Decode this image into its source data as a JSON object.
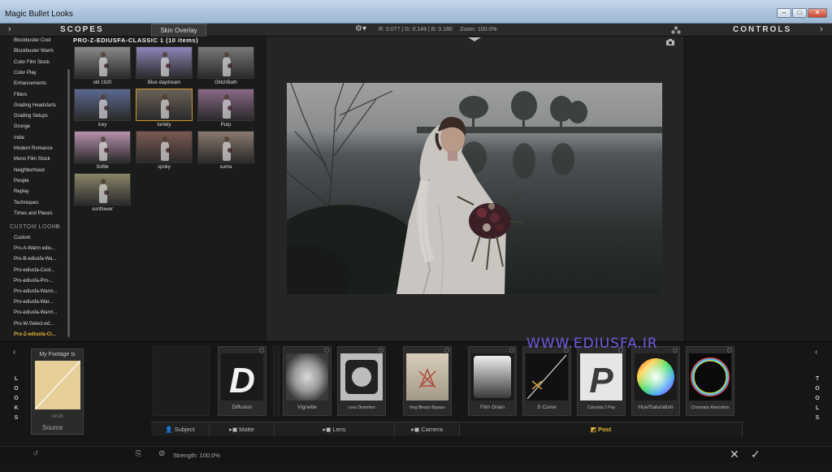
{
  "window": {
    "title": "Magic Bullet Looks",
    "buttons": [
      "–",
      "□",
      "✕"
    ]
  },
  "header": {
    "scopes_title": "SCOPES",
    "skin_tab": "Skin Overlay",
    "rgb_readout": "R: 0.077 | G: 0.149 | B: 0.180",
    "zoom_readout": "Zoom: 100.0%",
    "controls_title": "CONTROLS"
  },
  "looks_list": {
    "items": [
      "Blockbuster Cool",
      "Blockbuster Warm",
      "Color Film Stock",
      "Color Play",
      "Enhancements",
      "Filters",
      "Grading Headstarts",
      "Grading Setups",
      "Grunge",
      "Indie",
      "Modern Romance",
      "Mono Film Stock",
      "Neighborhood",
      "People",
      "Replay",
      "Techniques",
      "Times and Places"
    ],
    "custom_header": "CUSTOM LOOKS",
    "custom_items": [
      "Custom",
      "Pro-A-Warm ediu...",
      "Pro-B-ediusfa-Wa...",
      "Pro-ediusfa-Cool...",
      "Pro-ediusfa-Pro-...",
      "Pro-ediusfa-Warm...",
      "Pro-ediusfa-War...",
      "Pro-ediusfa-Warm...",
      "Pro-W-Select-ed...",
      "Pro-Z-ediusfa-Cl..."
    ],
    "active_item": "Pro-Z-ediusfa-Cl..."
  },
  "looks_grid": {
    "title": "PRO-Z-EDIUSFA-CLASSIC 1 (10 items)",
    "thumbs": [
      {
        "label": "old 1920",
        "bg": "#8a8a8a"
      },
      {
        "label": "Blue daydream",
        "bg": "#8e85b8"
      },
      {
        "label": "GlitchBath",
        "bg": "#787878"
      },
      {
        "label": "icey",
        "bg": "#5c6a90"
      },
      {
        "label": "lonlely",
        "bg": "#6a6258"
      },
      {
        "label": "Purp",
        "bg": "#8a6a86"
      },
      {
        "label": "Sofite",
        "bg": "#b892ad"
      },
      {
        "label": "spoky",
        "bg": "#7a5a52"
      },
      {
        "label": "suma",
        "bg": "#8a7a70"
      },
      {
        "label": "sunflower",
        "bg": "#8a8668"
      }
    ],
    "selected": "lonlely"
  },
  "source": {
    "title": "My Footage Is",
    "sub": "sRGB",
    "label": "Source"
  },
  "side_labels": {
    "looks": [
      "L",
      "O",
      "O",
      "K",
      "S"
    ],
    "tools": [
      "T",
      "O",
      "O",
      "L",
      "S"
    ]
  },
  "tools": [
    {
      "label": "Diffusion",
      "glyph": "D"
    },
    {
      "label": "Vignette"
    },
    {
      "label": "Lens Distortion"
    },
    {
      "label": "Neg Bleach Bypass"
    },
    {
      "label": "Film Grain"
    },
    {
      "label": "S Curve"
    },
    {
      "label": "Colorista 3 Pop",
      "glyph": "P"
    },
    {
      "label": "Hue/Saturation"
    },
    {
      "label": "Chromatic Aberration"
    }
  ],
  "categories": [
    "Subject",
    "Matte",
    "Lens",
    "Camera",
    "Post"
  ],
  "active_category": "Post",
  "status": {
    "strength": "Strength: 100.0%"
  },
  "watermark": "WWW.EDIUSFA.IR"
}
